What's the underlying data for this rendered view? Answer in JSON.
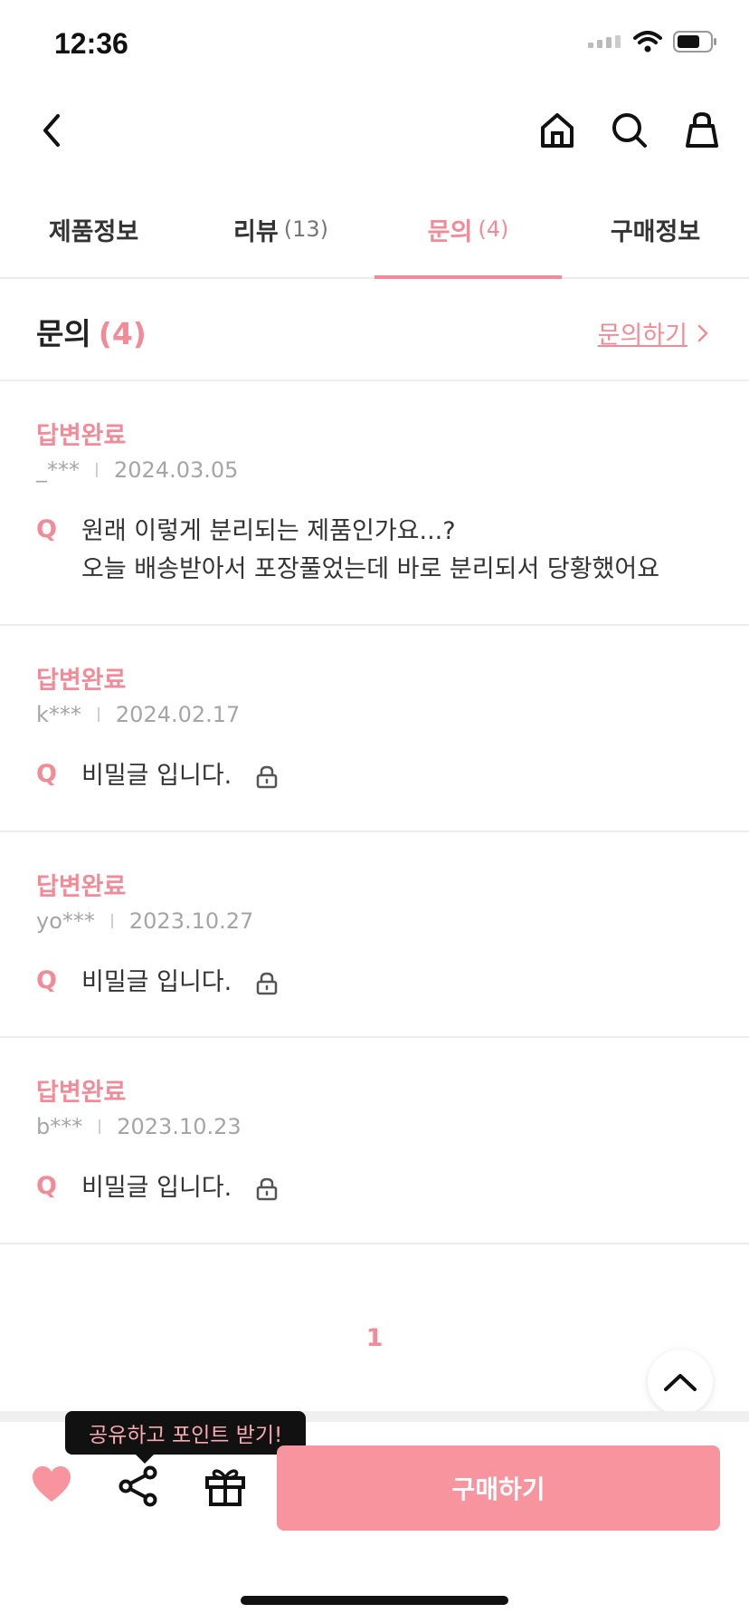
{
  "status_bar": {
    "time": "12:36"
  },
  "tabs": [
    {
      "label": "제품정보",
      "count": ""
    },
    {
      "label": "리뷰",
      "count": "(13)"
    },
    {
      "label": "문의",
      "count": "(4)"
    },
    {
      "label": "구매정보",
      "count": ""
    }
  ],
  "qa_header": {
    "title": "문의",
    "count": "(4)",
    "link_label": "문의하기"
  },
  "items": [
    {
      "status": "답변완료",
      "user": "_***",
      "date": "2024.03.05",
      "q": "Q",
      "line1": "원래 이렇게 분리되는 제품인가요...?",
      "line2": "오늘 배송받아서 포장풀었는데 바로 분리되서 당황했어요"
    },
    {
      "status": "답변완료",
      "user": "k***",
      "date": "2024.02.17",
      "q": "Q",
      "text": "비밀글 입니다."
    },
    {
      "status": "답변완료",
      "user": "yo***",
      "date": "2023.10.27",
      "q": "Q",
      "text": "비밀글 입니다."
    },
    {
      "status": "답변완료",
      "user": "b***",
      "date": "2023.10.23",
      "q": "Q",
      "text": "비밀글 입니다."
    }
  ],
  "pagination": {
    "current": "1"
  },
  "bottom": {
    "tooltip": "공유하고 포인트 받기!",
    "buy_label": "구매하기"
  },
  "colors": {
    "accent": "#f28b98",
    "buy_button": "#f8949e"
  }
}
